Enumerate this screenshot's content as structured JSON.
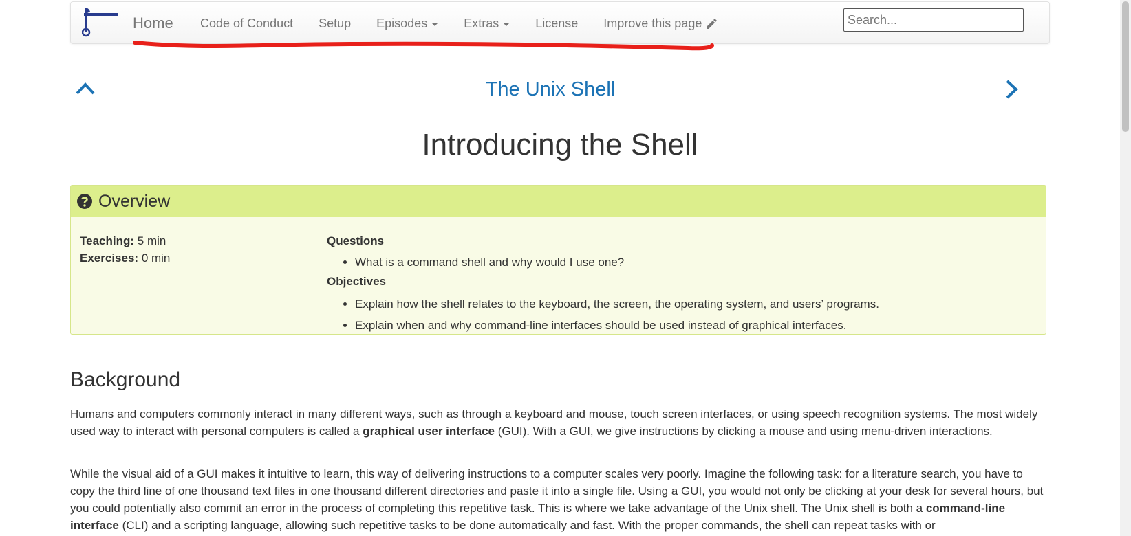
{
  "navbar": {
    "logo_icon": "carpentries-hammer-icon",
    "home_label": "Home",
    "links": [
      {
        "label": "Code of Conduct",
        "dropdown": false
      },
      {
        "label": "Setup",
        "dropdown": false
      },
      {
        "label": "Episodes",
        "dropdown": true
      },
      {
        "label": "Extras",
        "dropdown": true
      },
      {
        "label": "License",
        "dropdown": false
      },
      {
        "label": "Improve this page",
        "dropdown": false,
        "icon": "pencil-icon"
      }
    ],
    "search_placeholder": "Search...",
    "annotation_color": "#e8201a"
  },
  "lesson_nav": {
    "title": "The Unix Shell",
    "prev_icon": "chevron-up-icon",
    "next_icon": "chevron-right-icon",
    "link_color": "#1c73b5"
  },
  "page_title": "Introducing the Shell",
  "overview": {
    "heading": "Overview",
    "header_color": "#dcee8c",
    "teaching_label": "Teaching:",
    "teaching_value": "5 min",
    "exercises_label": "Exercises:",
    "exercises_value": "0 min",
    "questions_label": "Questions",
    "questions": [
      "What is a command shell and why would I use one?"
    ],
    "objectives_label": "Objectives",
    "objectives": [
      "Explain how the shell relates to the keyboard, the screen, the operating system, and users’ programs.",
      "Explain when and why command-line interfaces should be used instead of graphical interfaces."
    ]
  },
  "background": {
    "heading": "Background",
    "p1": {
      "a": "Humans and computers commonly interact in many different ways, such as through a keyboard and mouse, touch screen interfaces, or using speech recognition systems. The most widely used way to interact with personal computers is called a ",
      "b": "graphical user interface",
      "c": " (GUI). With a GUI, we give instructions by clicking a mouse and using menu-driven interactions."
    },
    "p2": {
      "a": "While the visual aid of a GUI makes it intuitive to learn, this way of delivering instructions to a computer scales very poorly. Imagine the following task: for a literature search, you have to copy the third line of one thousand text files in one thousand different directories and paste it into a single file. Using a GUI, you would not only be clicking at your desk for several hours, but you could potentially also commit an error in the process of completing this repetitive task. This is where we take advantage of the Unix shell. The Unix shell is both a ",
      "b": "command-line interface",
      "c": " (CLI) and a scripting language, allowing such repetitive tasks to be done automatically and fast. With the proper commands, the shell can repeat tasks with or"
    }
  }
}
